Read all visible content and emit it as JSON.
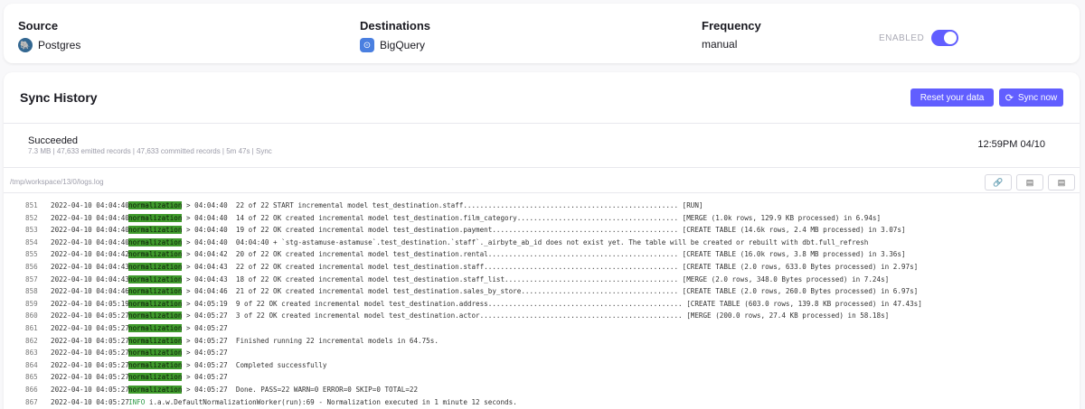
{
  "header": {
    "source": {
      "title": "Source",
      "value": "Postgres",
      "icon": "postgres-icon"
    },
    "destination": {
      "title": "Destinations",
      "value": "BigQuery",
      "icon": "bigquery-icon"
    },
    "frequency": {
      "title": "Frequency",
      "value": "manual"
    },
    "enabled_label": "ENABLED",
    "enabled": true
  },
  "sync_history": {
    "title": "Sync History",
    "reset_label": "Reset your data",
    "sync_label": "Sync now",
    "attempt": {
      "status": "Succeeded",
      "meta": "7.3 MB | 47,633 emitted records | 47,633 committed records | 5m 47s | Sync",
      "time": "12:59PM 04/10"
    },
    "log_path": "/tmp/workspace/13/0/logs.log"
  },
  "logs": [
    {
      "ln": "851",
      "ts": "2022-04-10 04:04:40",
      "tag": "normalization",
      "rest": " > 04:04:40  22 of 22 START incremental model test_destination.staff.................................................... [RUN]"
    },
    {
      "ln": "852",
      "ts": "2022-04-10 04:04:40",
      "tag": "normalization",
      "rest": " > 04:04:40  14 of 22 OK created incremental model test_destination.film_category....................................... [MERGE (1.0k rows, 129.9 KB processed) in 6.94s]"
    },
    {
      "ln": "853",
      "ts": "2022-04-10 04:04:40",
      "tag": "normalization",
      "rest": " > 04:04:40  19 of 22 OK created incremental model test_destination.payment............................................. [CREATE TABLE (14.6k rows, 2.4 MB processed) in 3.07s]"
    },
    {
      "ln": "854",
      "ts": "2022-04-10 04:04:40",
      "tag": "normalization",
      "rest": " > 04:04:40  04:04:40 + `stg-astamuse-astamuse`.test_destination.`staff`._airbyte_ab_id does not exist yet. The table will be created or rebuilt with dbt.full_refresh"
    },
    {
      "ln": "855",
      "ts": "2022-04-10 04:04:42",
      "tag": "normalization",
      "rest": " > 04:04:42  20 of 22 OK created incremental model test_destination.rental.............................................. [CREATE TABLE (16.0k rows, 3.8 MB processed) in 3.36s]"
    },
    {
      "ln": "856",
      "ts": "2022-04-10 04:04:43",
      "tag": "normalization",
      "rest": " > 04:04:43  22 of 22 OK created incremental model test_destination.staff............................................... [CREATE TABLE (2.0 rows, 633.0 Bytes processed) in 2.97s]"
    },
    {
      "ln": "857",
      "ts": "2022-04-10 04:04:43",
      "tag": "normalization",
      "rest": " > 04:04:43  18 of 22 OK created incremental model test_destination.staff_list.......................................... [MERGE (2.0 rows, 348.0 Bytes processed) in 7.24s]"
    },
    {
      "ln": "858",
      "ts": "2022-04-10 04:04:46",
      "tag": "normalization",
      "rest": " > 04:04:46  21 of 22 OK created incremental model test_destination.sales_by_store...................................... [CREATE TABLE (2.0 rows, 260.0 Bytes processed) in 6.97s]"
    },
    {
      "ln": "859",
      "ts": "2022-04-10 04:05:19",
      "tag": "normalization",
      "rest": " > 04:05:19  9 of 22 OK created incremental model test_destination.address............................................... [CREATE TABLE (603.0 rows, 139.8 KB processed) in 47.43s]"
    },
    {
      "ln": "860",
      "ts": "2022-04-10 04:05:27",
      "tag": "normalization",
      "rest": " > 04:05:27  3 of 22 OK created incremental model test_destination.actor................................................. [MERGE (200.0 rows, 27.4 KB processed) in 58.18s]"
    },
    {
      "ln": "861",
      "ts": "2022-04-10 04:05:27",
      "tag": "normalization",
      "rest": " > 04:05:27"
    },
    {
      "ln": "862",
      "ts": "2022-04-10 04:05:27",
      "tag": "normalization",
      "rest": " > 04:05:27  Finished running 22 incremental models in 64.75s."
    },
    {
      "ln": "863",
      "ts": "2022-04-10 04:05:27",
      "tag": "normalization",
      "rest": " > 04:05:27"
    },
    {
      "ln": "864",
      "ts": "2022-04-10 04:05:27",
      "tag": "normalization",
      "rest": " > 04:05:27  Completed successfully"
    },
    {
      "ln": "865",
      "ts": "2022-04-10 04:05:27",
      "tag": "normalization",
      "rest": " > 04:05:27"
    },
    {
      "ln": "866",
      "ts": "2022-04-10 04:05:27",
      "tag": "normalization",
      "rest": " > 04:05:27  Done. PASS=22 WARN=0 ERROR=0 SKIP=0 TOTAL=22"
    },
    {
      "ln": "867",
      "ts": "2022-04-10 04:05:27",
      "tag": "INFO",
      "rest": " i.a.w.DefaultNormalizationWorker(run):69 - Normalization executed in 1 minute 12 seconds."
    }
  ],
  "colors": {
    "accent": "#615eff",
    "normalization_tag": "#3f9a2c",
    "info": "#2e9a46"
  }
}
